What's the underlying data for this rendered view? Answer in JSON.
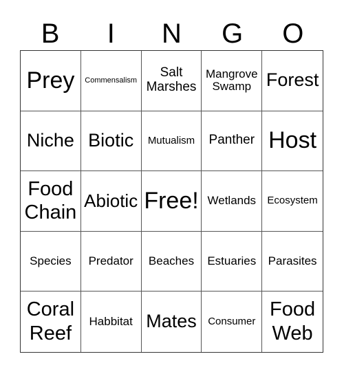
{
  "header": [
    "B",
    "I",
    "N",
    "G",
    "O"
  ],
  "cells": [
    {
      "text": "Prey",
      "size": "s-xl"
    },
    {
      "text": "Commensalism",
      "size": "s-xxs"
    },
    {
      "text": "Salt\nMarshes",
      "size": "s-n"
    },
    {
      "text": "Mangrove\nSwamp",
      "size": "s-s"
    },
    {
      "text": "Forest",
      "size": "s-m"
    },
    {
      "text": "Niche",
      "size": "s-m"
    },
    {
      "text": "Biotic",
      "size": "s-m"
    },
    {
      "text": "Mutualism",
      "size": "s-xs"
    },
    {
      "text": "Panther",
      "size": "s-n"
    },
    {
      "text": "Host",
      "size": "s-xl"
    },
    {
      "text": "Food\nChain",
      "size": "s-l"
    },
    {
      "text": "Abiotic",
      "size": "s-ml"
    },
    {
      "text": "Free!",
      "size": "s-xl"
    },
    {
      "text": "Wetlands",
      "size": "s-s"
    },
    {
      "text": "Ecosystem",
      "size": "s-xs"
    },
    {
      "text": "Species",
      "size": "s-s"
    },
    {
      "text": "Predator",
      "size": "s-s"
    },
    {
      "text": "Beaches",
      "size": "s-s"
    },
    {
      "text": "Estuaries",
      "size": "s-s"
    },
    {
      "text": "Parasites",
      "size": "s-s"
    },
    {
      "text": "Coral\nReef",
      "size": "s-l"
    },
    {
      "text": "Habbitat",
      "size": "s-s"
    },
    {
      "text": "Mates",
      "size": "s-m"
    },
    {
      "text": "Consumer",
      "size": "s-xs"
    },
    {
      "text": "Food\nWeb",
      "size": "s-l"
    }
  ]
}
